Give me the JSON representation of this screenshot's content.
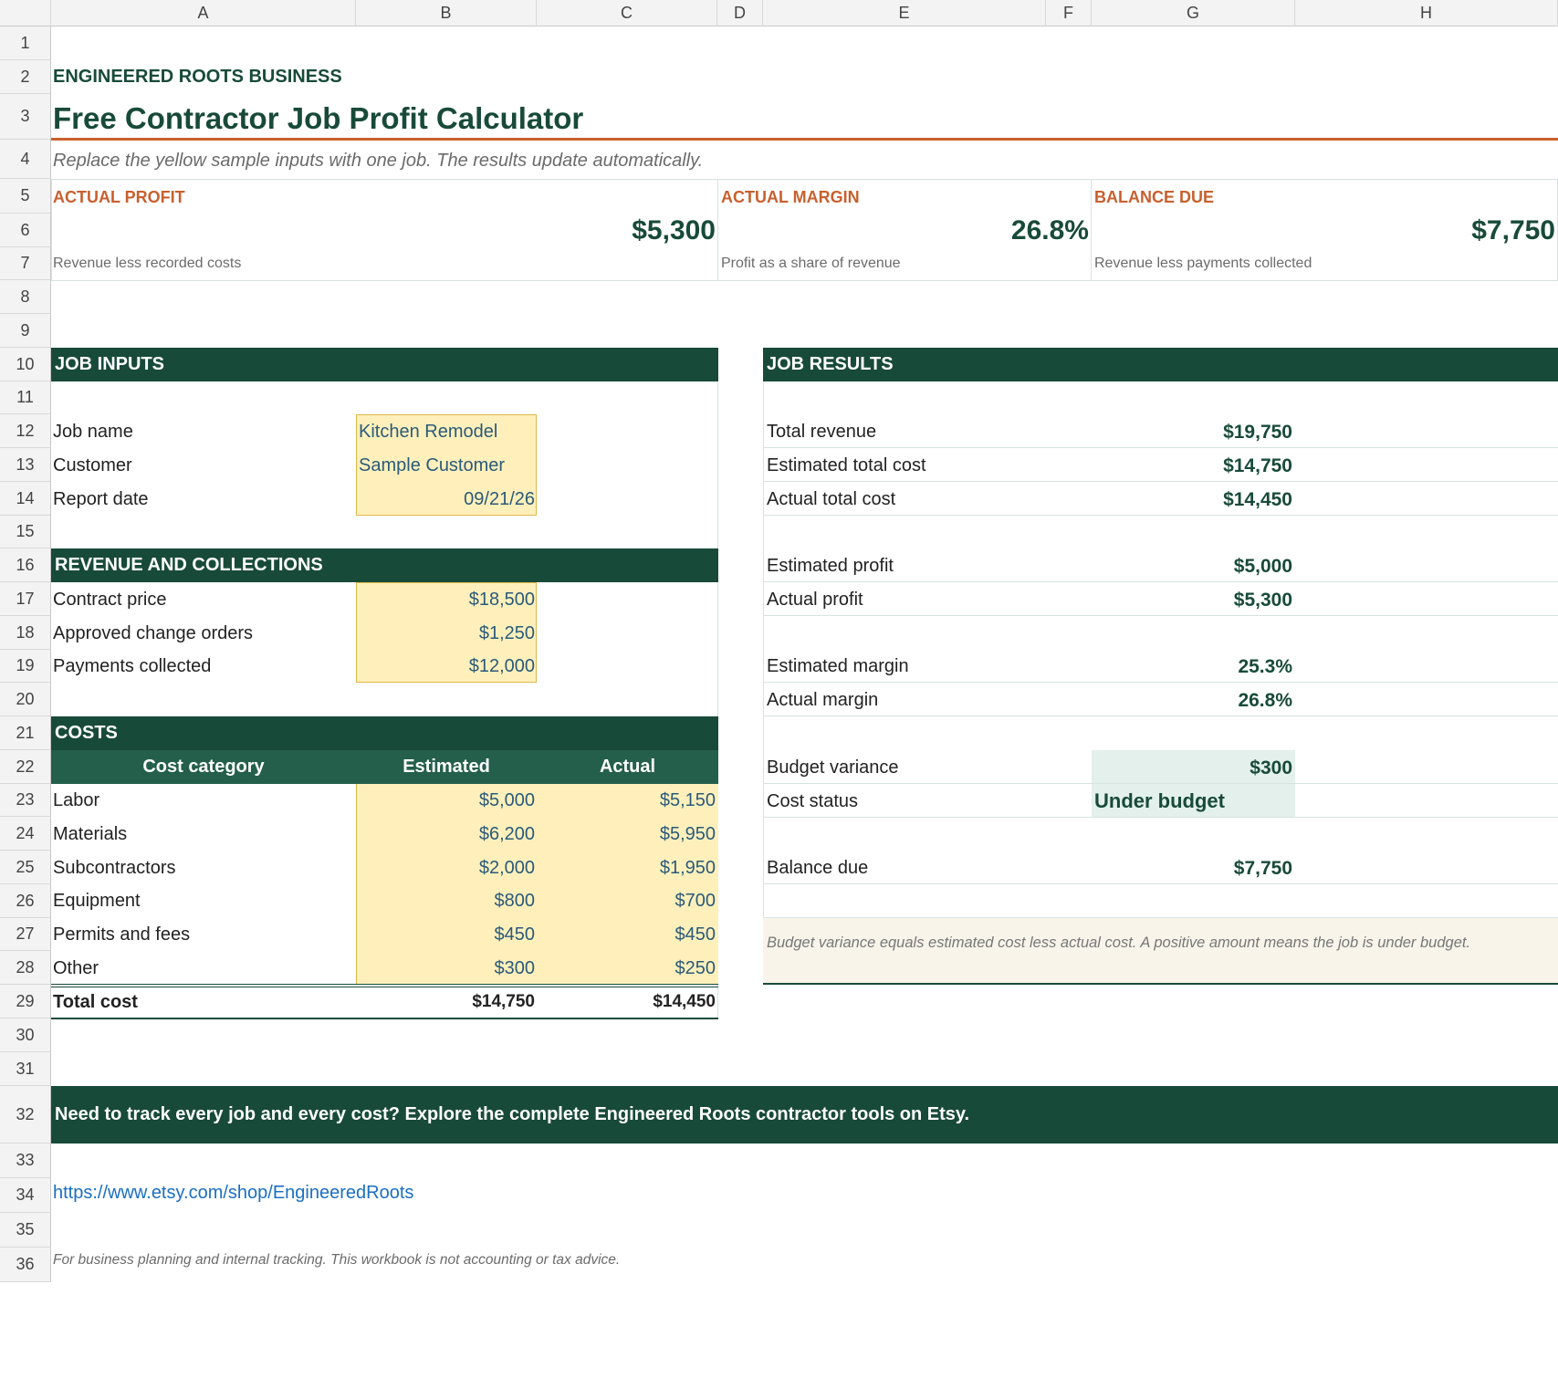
{
  "columns": [
    "A",
    "B",
    "C",
    "D",
    "E",
    "F",
    "G",
    "H"
  ],
  "rows": [
    "1",
    "2",
    "3",
    "4",
    "5",
    "6",
    "7",
    "8",
    "9",
    "10",
    "11",
    "12",
    "13",
    "14",
    "15",
    "16",
    "17",
    "18",
    "19",
    "20",
    "21",
    "22",
    "23",
    "24",
    "25",
    "26",
    "27",
    "28",
    "29",
    "30",
    "31",
    "32",
    "33",
    "34",
    "35",
    "36"
  ],
  "brand": "ENGINEERED ROOTS BUSINESS",
  "title": "Free Contractor Job Profit Calculator",
  "subtitle": "Replace the yellow sample inputs with one job. The results update automatically.",
  "kpis": [
    {
      "label": "ACTUAL PROFIT",
      "value": "$5,300",
      "note": "Revenue less recorded costs"
    },
    {
      "label": "ACTUAL MARGIN",
      "value": "26.8%",
      "note": "Profit as a share of revenue"
    },
    {
      "label": "BALANCE DUE",
      "value": "$7,750",
      "note": "Revenue less payments collected"
    }
  ],
  "job_inputs": {
    "header": "JOB INPUTS",
    "items": [
      {
        "label": "Job name",
        "value": "Kitchen Remodel"
      },
      {
        "label": "Customer",
        "value": "Sample Customer"
      },
      {
        "label": "Report date",
        "value": "09/21/26"
      }
    ]
  },
  "revenue": {
    "header": "REVENUE AND COLLECTIONS",
    "items": [
      {
        "label": "Contract price",
        "value": "$18,500"
      },
      {
        "label": "Approved change orders",
        "value": "$1,250"
      },
      {
        "label": "Payments collected",
        "value": "$12,000"
      }
    ]
  },
  "costs": {
    "header": "COSTS",
    "col_category": "Cost category",
    "col_estimated": "Estimated",
    "col_actual": "Actual",
    "items": [
      {
        "category": "Labor",
        "estimated": "$5,000",
        "actual": "$5,150"
      },
      {
        "category": "Materials",
        "estimated": "$6,200",
        "actual": "$5,950"
      },
      {
        "category": "Subcontractors",
        "estimated": "$2,000",
        "actual": "$1,950"
      },
      {
        "category": "Equipment",
        "estimated": "$800",
        "actual": "$700"
      },
      {
        "category": "Permits and fees",
        "estimated": "$450",
        "actual": "$450"
      },
      {
        "category": "Other",
        "estimated": "$300",
        "actual": "$250"
      }
    ],
    "total_label": "Total cost",
    "total_estimated": "$14,750",
    "total_actual": "$14,450"
  },
  "results": {
    "header": "JOB RESULTS",
    "total_revenue": {
      "label": "Total revenue",
      "value": "$19,750"
    },
    "estimated_total_cost": {
      "label": "Estimated total cost",
      "value": "$14,750"
    },
    "actual_total_cost": {
      "label": "Actual total cost",
      "value": "$14,450"
    },
    "estimated_profit": {
      "label": "Estimated profit",
      "value": "$5,000"
    },
    "actual_profit": {
      "label": "Actual profit",
      "value": "$5,300"
    },
    "estimated_margin": {
      "label": "Estimated margin",
      "value": "25.3%"
    },
    "actual_margin": {
      "label": "Actual margin",
      "value": "26.8%"
    },
    "budget_variance": {
      "label": "Budget variance",
      "value": "$300"
    },
    "cost_status": {
      "label": "Cost status",
      "value": "Under budget"
    },
    "balance_due": {
      "label": "Balance due",
      "value": "$7,750"
    },
    "note": "Budget variance equals estimated cost less actual cost. A positive amount means the job is under budget."
  },
  "cta": "Need to track every job and every cost? Explore the complete Engineered Roots contractor tools on Etsy.",
  "link": "https://www.etsy.com/shop/EngineeredRoots",
  "disclaimer": "For business planning and internal tracking. This workbook is not accounting or tax advice.",
  "colors": {
    "brand_green": "#184a3a",
    "accent_orange": "#c8602e",
    "input_yellow": "#fff0bb",
    "status_green_fill": "#e3f0eb",
    "note_fill": "#f8f4ea",
    "link_blue": "#1a6fc2"
  }
}
